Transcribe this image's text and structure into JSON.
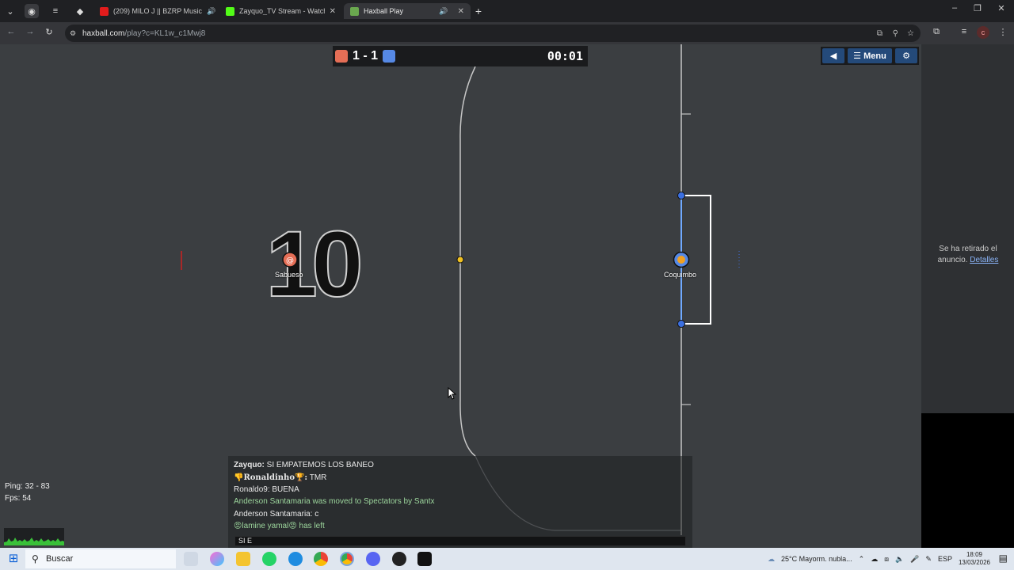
{
  "browser": {
    "tabs": [
      {
        "label": "(209) MILO J || BZRP Music",
        "favicon_color": "#e21c1c",
        "muted_icon": "speaker-icon"
      },
      {
        "label": "Zayquo_TV Stream - Watch Live",
        "favicon_color": "#53fc18"
      },
      {
        "label": "Haxball Play",
        "favicon_color": "#6aa84f",
        "active": true,
        "muted_icon": "speaker-icon"
      }
    ],
    "url_domain": "haxball.com",
    "url_path": "/play?c=KL1w_c1Mwj8"
  },
  "scoreboard": {
    "red_color": "#e56e56",
    "blue_color": "#5689e5",
    "score": "1 - 1",
    "timer": "00:01"
  },
  "top_buttons": {
    "menu_label": "Menu"
  },
  "players": [
    {
      "name": "Sabueso",
      "team": "red",
      "avatar": "@"
    },
    {
      "name": "Coquimbo",
      "team": "blue"
    }
  ],
  "jersey_number": "10",
  "ad_panel": {
    "text": "Se ha retirado el anuncio.",
    "link": "Detalles"
  },
  "chat": {
    "messages": [
      {
        "sender": "Zayquo:",
        "text": " SI EMPATEMOS LOS BANEO"
      },
      {
        "sender": "👎Ronaldinho🏆:",
        "text": " TMR"
      },
      {
        "sender": "",
        "text": "Ronaldo9: BUENA"
      },
      {
        "sender": "",
        "text": "Anderson Santamaria was moved to Spectators by Santx",
        "system": true
      },
      {
        "sender": "",
        "text": "Anderson Santamaria: c"
      },
      {
        "sender": "",
        "text": "😡lamine yamal😡 has left",
        "system": true
      }
    ],
    "input_value": "SI E"
  },
  "stats": {
    "ping": "Ping: 32 - 83",
    "fps": "Fps: 54"
  },
  "taskbar": {
    "search_placeholder": "Buscar",
    "weather": "25°C  Mayorm. nubla...",
    "lang": "ESP",
    "time": "18:09",
    "date": "13/03/2026"
  }
}
